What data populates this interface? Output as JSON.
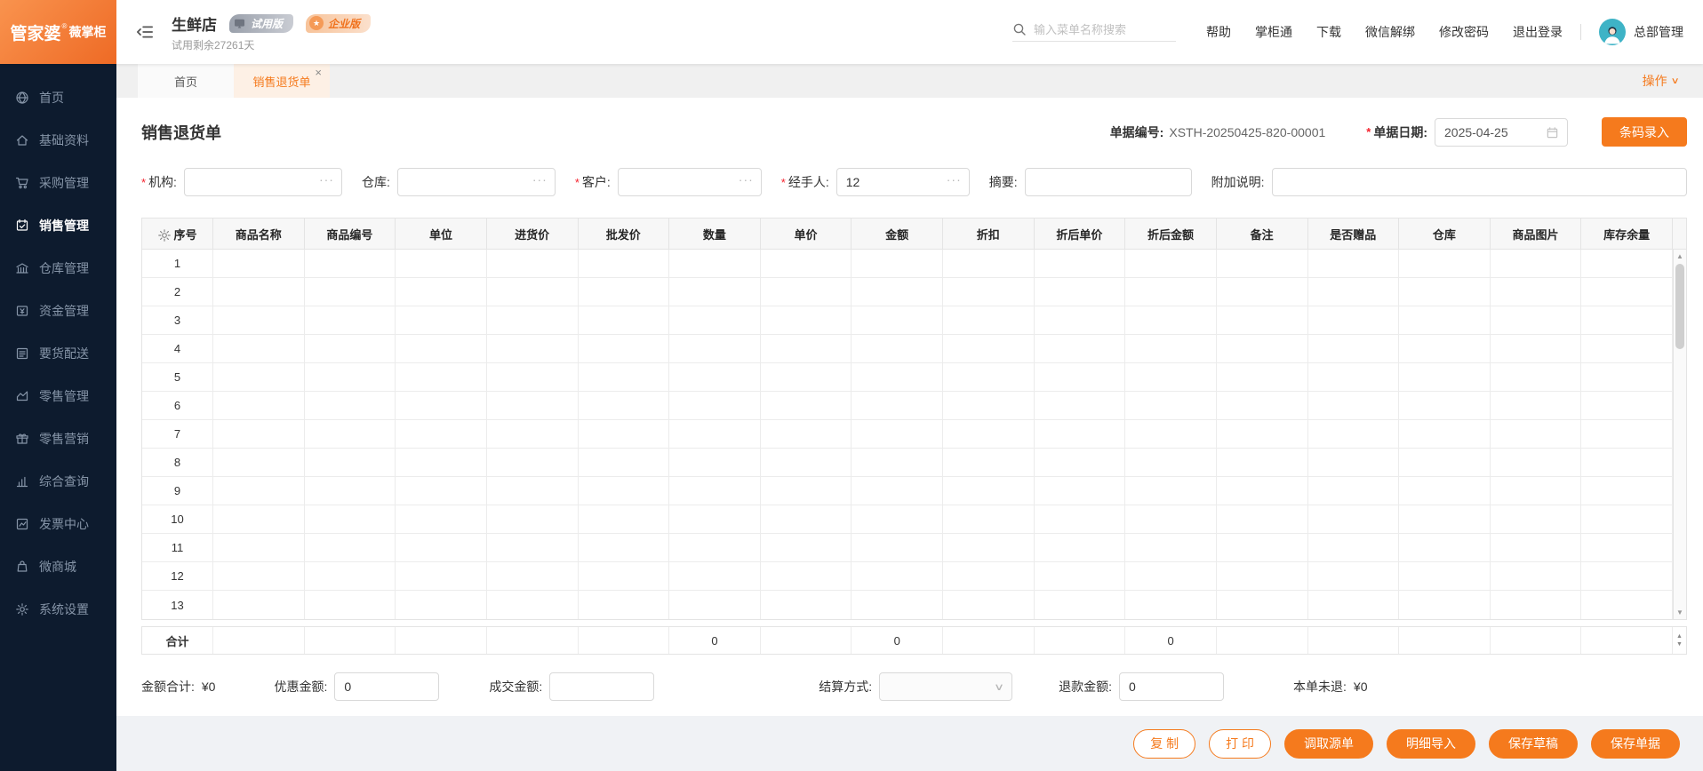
{
  "theme": {
    "accent": "#f57a1d",
    "sidebar_bg": "#0d1b2e",
    "active_tab_bg": "#fdf0e5"
  },
  "brand": {
    "name": "管家婆",
    "reg_mark": "®",
    "product": "薇掌柜"
  },
  "header": {
    "store_name": "生鲜店",
    "trial_remaining": "试用剩余27261天",
    "badges": [
      {
        "label": "试用版",
        "icon": "monitor-icon",
        "type": "trial"
      },
      {
        "label": "企业版",
        "icon": "star-icon",
        "type": "enterprise",
        "star": "★"
      }
    ],
    "search_placeholder": "输入菜单名称搜索",
    "menu": [
      "帮助",
      "掌柜通",
      "下载",
      "微信解绑",
      "修改密码",
      "退出登录"
    ],
    "user_name": "总部管理"
  },
  "sidebar": {
    "items": [
      {
        "label": "首页",
        "icon": "globe-icon",
        "active": false
      },
      {
        "label": "基础资料",
        "icon": "home-icon",
        "active": false
      },
      {
        "label": "采购管理",
        "icon": "cart-icon",
        "active": false
      },
      {
        "label": "销售管理",
        "icon": "calendar-check-icon",
        "active": true
      },
      {
        "label": "仓库管理",
        "icon": "bank-icon",
        "active": false
      },
      {
        "label": "资金管理",
        "icon": "money-icon",
        "active": false
      },
      {
        "label": "要货配送",
        "icon": "delivery-list-icon",
        "active": false
      },
      {
        "label": "零售管理",
        "icon": "area-chart-icon",
        "active": false
      },
      {
        "label": "零售营销",
        "icon": "gift-icon",
        "active": false
      },
      {
        "label": "综合查询",
        "icon": "bar-chart-icon",
        "active": false
      },
      {
        "label": "发票中心",
        "icon": "line-chart-icon",
        "active": false
      },
      {
        "label": "微商城",
        "icon": "shopping-bag-icon",
        "active": false
      },
      {
        "label": "系统设置",
        "icon": "gear-icon",
        "active": false
      }
    ]
  },
  "tabs": [
    {
      "label": "首页",
      "active": false,
      "closable": false
    },
    {
      "label": "销售退货单",
      "active": true,
      "closable": true
    }
  ],
  "actions_menu_label": "操作",
  "doc": {
    "title": "销售退货单",
    "number_label": "单据编号:",
    "number": "XSTH-20250425-820-00001",
    "date_label": "单据日期:",
    "date_value": "2025-04-25",
    "barcode_button": "条码录入"
  },
  "form": {
    "fields": [
      {
        "label": "机构:",
        "required": true,
        "value": "",
        "trigger": "···"
      },
      {
        "label": "仓库:",
        "required": false,
        "value": "",
        "trigger": "···"
      },
      {
        "label": "客户:",
        "required": true,
        "value": "",
        "trigger": "···"
      },
      {
        "label": "经手人:",
        "required": true,
        "value": "12",
        "trigger": "···"
      },
      {
        "label": "摘要:",
        "required": false,
        "value": "",
        "trigger": ""
      },
      {
        "label": "附加说明:",
        "required": false,
        "value": "",
        "trigger": ""
      }
    ]
  },
  "table": {
    "columns": [
      "序号",
      "商品名称",
      "商品编号",
      "单位",
      "进货价",
      "批发价",
      "数量",
      "单价",
      "金额",
      "折扣",
      "折后单价",
      "折后金额",
      "备注",
      "是否赠品",
      "仓库",
      "商品图片",
      "库存余量"
    ],
    "row_numbers": [
      "1",
      "2",
      "3",
      "4",
      "5",
      "6",
      "7",
      "8",
      "9",
      "10",
      "11",
      "12",
      "13"
    ],
    "totals_by_column": [
      "合计",
      "",
      "",
      "",
      "",
      "",
      "0",
      "",
      "0",
      "",
      "",
      "0",
      "",
      "",
      "",
      "",
      ""
    ]
  },
  "summary": {
    "amount_total_label": "金额合计:",
    "amount_total": "¥0",
    "discount_label": "优惠金额:",
    "discount_value": "0",
    "deal_label": "成交金额:",
    "deal_value": "",
    "settle_label": "结算方式:",
    "settle_value": "",
    "refund_label": "退款金额:",
    "refund_value": "0",
    "unreturned_label": "本单未退:",
    "unreturned_value": "¥0"
  },
  "footer_buttons": [
    {
      "label": "复 制",
      "style": "outline"
    },
    {
      "label": "打 印",
      "style": "outline"
    },
    {
      "label": "调取源单",
      "style": "filled"
    },
    {
      "label": "明细导入",
      "style": "filled"
    },
    {
      "label": "保存草稿",
      "style": "filled"
    },
    {
      "label": "保存单据",
      "style": "filled"
    }
  ]
}
